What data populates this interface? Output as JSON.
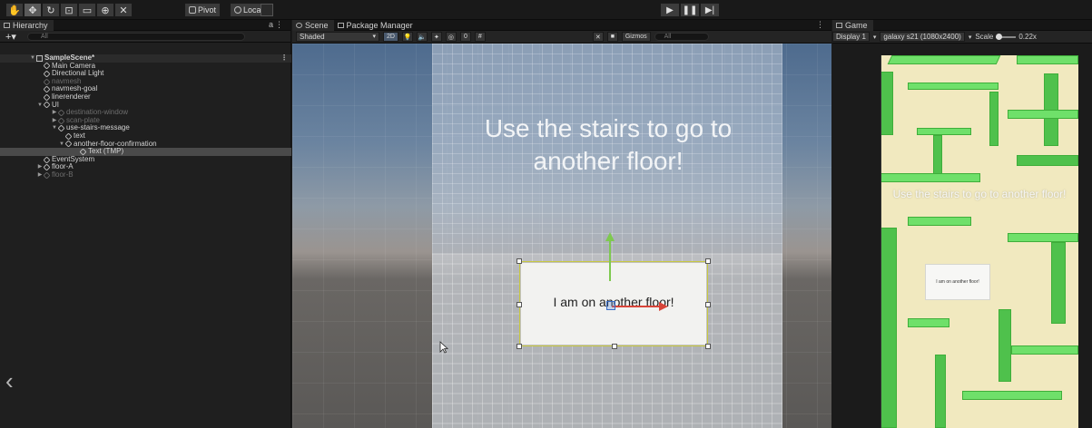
{
  "toolbar": {
    "pivot_label": "Pivot",
    "local_label": "Local",
    "tools": [
      "hand-icon",
      "move-icon",
      "rotate-icon",
      "scale-icon",
      "rect-icon",
      "transform-icon",
      "custom-tool-icon"
    ],
    "play_controls": [
      "play-icon",
      "pause-icon",
      "step-icon"
    ]
  },
  "hierarchy": {
    "tab_label": "Hierarchy",
    "panel_menu": "⋮",
    "add_label": "+▾",
    "search_placeholder": "All",
    "items": [
      {
        "label": "SampleScene*",
        "depth": 0,
        "type": "scene",
        "expanded": true
      },
      {
        "label": "Main Camera",
        "depth": 1
      },
      {
        "label": "Directional Light",
        "depth": 1
      },
      {
        "label": "navmesh",
        "depth": 1,
        "dim": true
      },
      {
        "label": "navmesh-goal",
        "depth": 1
      },
      {
        "label": "linerenderer",
        "depth": 1
      },
      {
        "label": "UI",
        "depth": 1,
        "expanded": true
      },
      {
        "label": "destination-window",
        "depth": 2,
        "dim": true,
        "collapsed": true
      },
      {
        "label": "scan-plate",
        "depth": 2,
        "dim": true,
        "collapsed": true
      },
      {
        "label": "use-stairs-message",
        "depth": 2,
        "expanded": true
      },
      {
        "label": "text",
        "depth": 3
      },
      {
        "label": "another-floor-confirmation",
        "depth": 3,
        "expanded": true
      },
      {
        "label": "Text (TMP)",
        "depth": 4,
        "selected": true
      },
      {
        "label": "EventSystem",
        "depth": 1
      },
      {
        "label": "floor-A",
        "depth": 1,
        "collapsed": true
      },
      {
        "label": "floor-B",
        "depth": 1,
        "dim": true,
        "collapsed": true
      }
    ]
  },
  "scene_view": {
    "tabs": [
      {
        "label": "Scene",
        "active": true
      },
      {
        "label": "Package Manager",
        "active": false
      }
    ],
    "shading": "Shaded",
    "mode_2d": "2D",
    "layer_count": "0",
    "gizmos_label": "Gizmos",
    "search_placeholder": "All",
    "heading": "Use the stairs to go to another floor!",
    "confirmation_text": "I am on another floor!"
  },
  "game_view": {
    "tab_label": "Game",
    "display": "Display 1",
    "resolution": "galaxy s21 (1080x2400)",
    "scale_label": "Scale",
    "scale_value": "0.22x",
    "heading": "Use the stairs to go to another floor!",
    "confirmation_text": "I am on another floor!"
  },
  "colors": {
    "maze_green": "#6fe06a",
    "floor_beige": "#f1e9bf",
    "selection": "#4a4a4a",
    "gizmo_y": "#7ec94f",
    "gizmo_x": "#d8453a"
  }
}
